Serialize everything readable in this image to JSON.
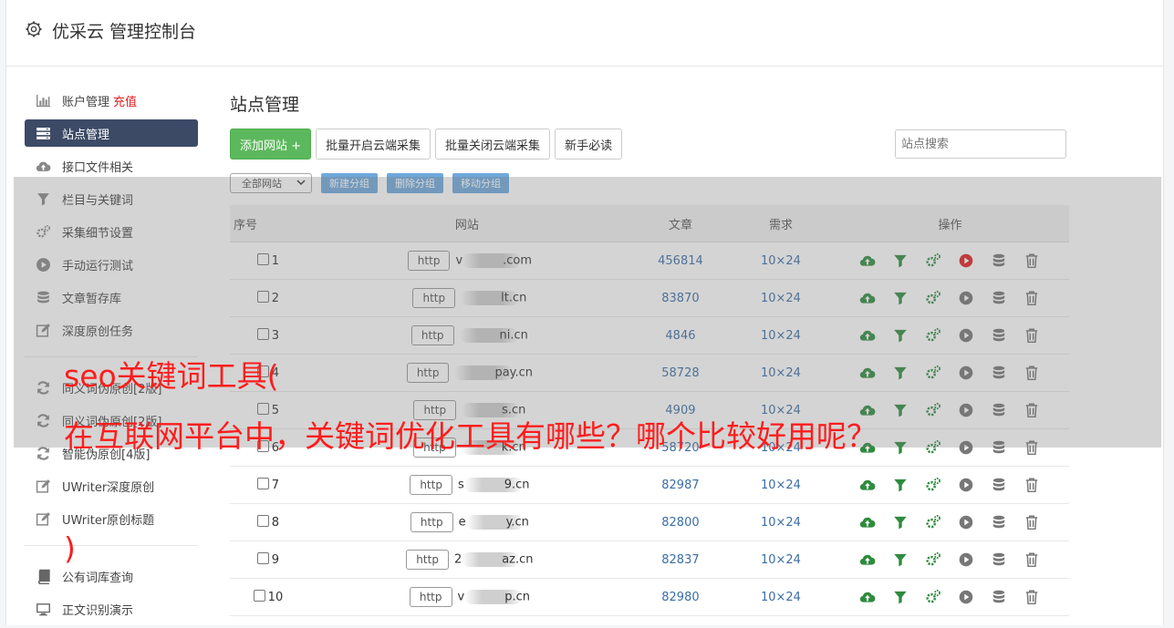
{
  "header": {
    "title": "优采云 管理控制台"
  },
  "sidebar": {
    "items": [
      {
        "label": "账户管理",
        "badge": "充值",
        "icon": "bar-chart-icon"
      },
      {
        "label": "站点管理",
        "icon": "server-icon",
        "active": true
      },
      {
        "label": "接口文件相关",
        "icon": "cloud-upload-icon"
      },
      {
        "label": "栏目与关键词",
        "icon": "filter-icon"
      },
      {
        "label": "采集细节设置",
        "icon": "gears-icon"
      },
      {
        "label": "手动运行测试",
        "icon": "play-circle-icon"
      },
      {
        "label": "文章暂存库",
        "icon": "database-icon"
      },
      {
        "label": "深度原创任务",
        "icon": "edit-icon"
      }
    ],
    "items2": [
      {
        "label": "同义词伪原创[2版]",
        "icon": "refresh-icon"
      },
      {
        "label": "同义词伪原创[2版]",
        "icon": "refresh-icon"
      },
      {
        "label": "智能伪原创[4版]",
        "icon": "refresh-icon"
      },
      {
        "label": "UWriter深度原创",
        "icon": "edit-icon"
      },
      {
        "label": "UWriter原创标题",
        "icon": "edit-icon"
      }
    ],
    "items3": [
      {
        "label": "公有词库查询",
        "icon": "book-icon"
      },
      {
        "label": "正文识别演示",
        "icon": "monitor-icon"
      }
    ]
  },
  "main": {
    "title": "站点管理",
    "buttons": {
      "add": "添加网站 +",
      "batch_open": "批量开启云端采集",
      "batch_close": "批量关闭云端采集",
      "guide": "新手必读"
    },
    "search_placeholder": "站点搜索",
    "group_select": "全部网站",
    "group_buttons": {
      "new": "新建分组",
      "delete": "删除分组",
      "move": "移动分组"
    }
  },
  "table": {
    "columns": [
      "序号",
      "网站",
      "文章",
      "需求",
      "操作"
    ],
    "rows": [
      {
        "no": "1",
        "protocol": "http",
        "domain_prefix": "v",
        "domain": ".com",
        "articles": "456814",
        "demand": "10×24",
        "running": true
      },
      {
        "no": "2",
        "protocol": "http",
        "domain_prefix": "",
        "domain": "lt.cn",
        "articles": "83870",
        "demand": "10×24",
        "running": false
      },
      {
        "no": "3",
        "protocol": "http",
        "domain_prefix": "",
        "domain": "ni.cn",
        "articles": "4846",
        "demand": "10×24",
        "running": false
      },
      {
        "no": "4",
        "protocol": "http",
        "domain_prefix": "",
        "domain": "pay.cn",
        "articles": "58728",
        "demand": "10×24",
        "running": false
      },
      {
        "no": "5",
        "protocol": "http",
        "domain_prefix": "",
        "domain": "s.cn",
        "articles": "4909",
        "demand": "10×24",
        "running": false
      },
      {
        "no": "6",
        "protocol": "http",
        "domain_prefix": "",
        "domain": "k.cn",
        "articles": "58720",
        "demand": "10×24",
        "running": false
      },
      {
        "no": "7",
        "protocol": "http",
        "domain_prefix": "s",
        "domain": "9.cn",
        "articles": "82987",
        "demand": "10×24",
        "running": false
      },
      {
        "no": "8",
        "protocol": "http",
        "domain_prefix": "e",
        "domain": "y.cn",
        "articles": "82800",
        "demand": "10×24",
        "running": false
      },
      {
        "no": "9",
        "protocol": "http",
        "domain_prefix": "2",
        "domain": "az.cn",
        "articles": "82837",
        "demand": "10×24",
        "running": false
      },
      {
        "no": "10",
        "protocol": "http",
        "domain_prefix": "v",
        "domain": "p.cn",
        "articles": "82980",
        "demand": "10×24",
        "running": false
      }
    ]
  },
  "watermark": {
    "line1": "seo关键词工具(",
    "line2": "在互联网平台中，关键词优化工具有哪些？哪个比较好用呢？",
    "line3": ")"
  },
  "colors": {
    "active_nav": "#3c4a66",
    "add_button": "#5cb85c",
    "group_button": "#6fa8dc",
    "link_number": "#3a6ea5",
    "watermark": "#ff1c1c",
    "running": "#e02020"
  }
}
